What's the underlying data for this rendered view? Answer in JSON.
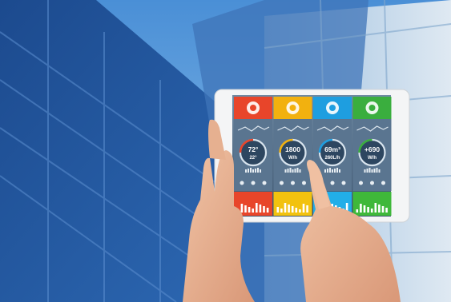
{
  "dashboard": {
    "panels": [
      {
        "icon": "thermometer-icon",
        "header_color": "#e8452a",
        "readout_line1": "72°",
        "readout_line2": "22°",
        "bottom_color": "#e8452a"
      },
      {
        "icon": "lightning-icon",
        "header_color": "#f2b10f",
        "readout_line1": "1800",
        "readout_line2": "W/h",
        "bottom_color": "#f2c20f"
      },
      {
        "icon": "water-drop-icon",
        "header_color": "#1e9ee0",
        "readout_line1": "69m³",
        "readout_line2": "260L/h",
        "bottom_color": "#22aee8"
      },
      {
        "icon": "leaf-icon",
        "header_color": "#3aae3e",
        "readout_line1": "+690",
        "readout_line2": "W/h",
        "bottom_color": "#3fb83a"
      }
    ]
  }
}
